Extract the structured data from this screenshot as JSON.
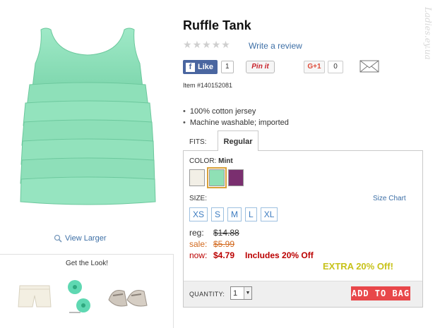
{
  "product": {
    "title": "Ruffle Tank",
    "item_number": "Item #140152081",
    "rating_stars": 0,
    "write_review": "Write a review",
    "features": [
      "100% cotton jersey",
      "Machine washable; imported"
    ],
    "image_icon": "ruffle-tank-image",
    "image_color": "#8fe3bf"
  },
  "social": {
    "fb_label": "Like",
    "fb_count": "1",
    "pin_label": "Pin it",
    "gplus_label": "G+1",
    "gplus_count": "0",
    "mail_icon": "envelope-icon"
  },
  "left": {
    "view_larger": "View Larger",
    "look_title": "Get the Look!",
    "look_items": [
      "shorts",
      "hair-flowers",
      "sandals"
    ]
  },
  "fits": {
    "label": "FITS:",
    "tab": "Regular"
  },
  "color": {
    "label": "COLOR:",
    "selected": "Mint",
    "swatches": [
      {
        "name": "ivory",
        "hex": "#f2efe6"
      },
      {
        "name": "mint",
        "hex": "#8fe0b5"
      },
      {
        "name": "purple",
        "hex": "#7a2f6f"
      }
    ]
  },
  "size": {
    "label": "SIZE:",
    "chart_link": "Size Chart",
    "options": [
      "XS",
      "S",
      "M",
      "L",
      "XL"
    ]
  },
  "price": {
    "reg_label": "reg:",
    "reg_value": "$14.88",
    "sale_label": "sale:",
    "sale_value": "$5.99",
    "now_label": "now:",
    "now_value": "$4.79",
    "includes": "Includes 20% Off",
    "extra": "EXTRA 20% Off!"
  },
  "cart": {
    "quantity_label": "QUANTITY:",
    "quantity_value": "1",
    "add_to_bag": "ADD TO BAG"
  },
  "watermark": "Ladies.ey.ua"
}
